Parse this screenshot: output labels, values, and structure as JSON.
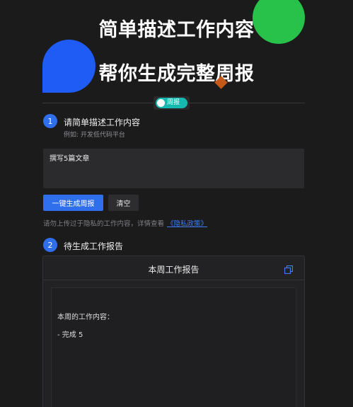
{
  "hero": {
    "line1": "简单描述工作内容",
    "line2": "帮你生成完整周报"
  },
  "mode_toggle": {
    "label": "周报",
    "on": true,
    "color": "#16b9b0"
  },
  "step1": {
    "number": "1",
    "title": "请简单描述工作内容",
    "hint": "例如: 开发低代码平台",
    "input_value": "撰写5篇文章"
  },
  "actions": {
    "generate_label": "一键生成周报",
    "clear_label": "清空"
  },
  "privacy": {
    "text": "请勿上传过于隐私的工作内容，详情查看",
    "link_label": "《隐私政策》"
  },
  "step2": {
    "number": "2",
    "title": "待生成工作报告"
  },
  "report": {
    "title": "本周工作报告",
    "line1": "本周的工作内容：",
    "line2": "- 完成 5",
    "copy_icon": "copy-icon"
  },
  "colors": {
    "accent": "#2f6fec",
    "background": "#1b1b1c",
    "link": "#3d7df0",
    "green_blob": "#28c24a",
    "blue_blob": "#1f5bf5",
    "diamond": "#c55a18"
  }
}
